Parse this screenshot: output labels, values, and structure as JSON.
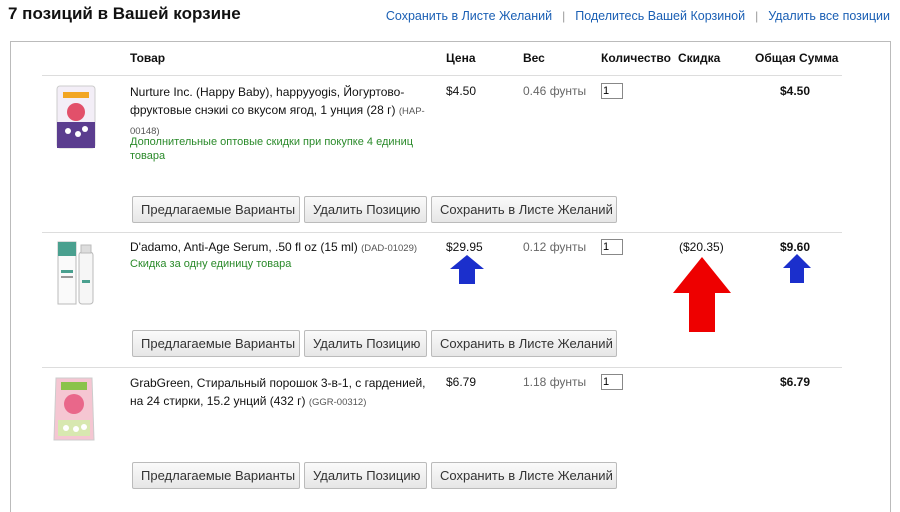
{
  "cart_title": "7 позиций в Вашей корзине",
  "top_links": {
    "save_wishlist": "Сохранить в Листе Желаний",
    "share_cart": "Поделитесь Вашей Корзиной",
    "delete_all": "Удалить все позиции"
  },
  "columns": {
    "product": "Товар",
    "price": "Цена",
    "weight": "Вес",
    "quantity": "Количество",
    "discount": "Скидка",
    "total": "Общая Сумма"
  },
  "buttons": {
    "suggested": "Предлагаемые Варианты",
    "remove": "Удалить Позицию",
    "save": "Сохранить в Листе Желаний"
  },
  "items": [
    {
      "name_line1": "Nurture Inc. (Happy Baby), happyyogis, Йогуртово-",
      "name_line2": "фруктовые снэкиi со вкусом ягод, 1 унция (28 г)",
      "sku_a": "(HAP-",
      "sku_b": "00148)",
      "note_line1": "Дополнительные оптовые скидки при покупке 4 единиц",
      "note_line2": "товара",
      "price": "$4.50",
      "weight": "0.46 фунты",
      "quantity": "1",
      "discount": "",
      "total": "$4.50"
    },
    {
      "name_line1": "D'adamo, Anti-Age Serum, .50 fl oz (15 ml)",
      "sku_a": "(DAD-01029)",
      "note_line1": "Скидка за одну единицу товара",
      "price": "$29.95",
      "weight": "0.12 фунты",
      "quantity": "1",
      "discount": "($20.35)",
      "total": "$9.60"
    },
    {
      "name_line1": "GrabGreen, Стиральный порошок 3-в-1, с гарденией,",
      "name_line2": "на 24 стирки, 15.2 унций (432 г)",
      "sku_a": "(GGR-00312)",
      "price": "$6.79",
      "weight": "1.18 фунты",
      "quantity": "1",
      "discount": "",
      "total": "$6.79"
    }
  ],
  "colors": {
    "link": "#1a5fb4",
    "note_green": "#2a8a2a",
    "arrow_blue": "#1b2fcc",
    "arrow_red": "#ee0000"
  }
}
